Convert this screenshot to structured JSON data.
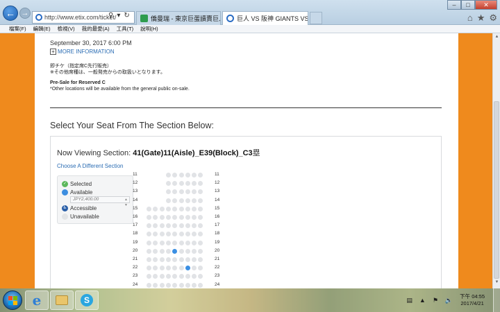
{
  "browser": {
    "url": "http://www.etix.com/ticket/",
    "tabs": [
      {
        "label": "僑曼瑞 - 東京巨蛋讀賣巨人主..."
      },
      {
        "label": "巨人 VS 阪神 GIANTS VS TI..."
      }
    ],
    "menu": [
      "檔案(F)",
      "編輯(E)",
      "檢視(V)",
      "我的最愛(A)",
      "工具(T)",
      "說明(H)"
    ]
  },
  "page": {
    "event_date": "September 30, 2017 6:00 PM",
    "more_info": "MORE INFORMATION",
    "jp_title": "即チケ（指定席C先行販売）",
    "jp_note": "※その他席種は、一般発売からの取扱いとなります。",
    "presale_title": "Pre-Sale for Reserved C",
    "presale_note": "*Other locations will be available from the general public on-sale.",
    "select_title": "Select Your Seat From The Section Below:",
    "viewing_prefix": "Now Viewing Section: ",
    "section_name": "41(Gate)11(Aisle)_E39(Block)_C3",
    "section_suffix": "塁",
    "choose_link": "Choose A Different Section",
    "legend": {
      "selected": "Selected",
      "available": "Available",
      "price_placeholder": "JPY2,400.00",
      "accessible": "Accessible",
      "unavailable": "Unavailable"
    },
    "seatmap": {
      "rows": [
        {
          "label": "11",
          "seats": 6,
          "start": 3
        },
        {
          "label": "12",
          "seats": 6,
          "start": 3
        },
        {
          "label": "13",
          "seats": 6,
          "start": 3
        },
        {
          "label": "14",
          "seats": 6,
          "start": 3
        },
        {
          "label": "15",
          "seats": 9,
          "start": 0
        },
        {
          "label": "16",
          "seats": 9,
          "start": 0
        },
        {
          "label": "17",
          "seats": 9,
          "start": 0
        },
        {
          "label": "18",
          "seats": 9,
          "start": 0
        },
        {
          "label": "19",
          "seats": 9,
          "start": 0
        },
        {
          "label": "20",
          "seats": 9,
          "start": 0,
          "available": [
            4
          ]
        },
        {
          "label": "21",
          "seats": 9,
          "start": 0
        },
        {
          "label": "22",
          "seats": 9,
          "start": 0,
          "available": [
            6
          ]
        },
        {
          "label": "23",
          "seats": 9,
          "start": 0
        },
        {
          "label": "24",
          "seats": 9,
          "start": 0
        }
      ]
    }
  },
  "taskbar": {
    "clock_period": "下午 04:55",
    "clock_date": "2017/4/21"
  }
}
